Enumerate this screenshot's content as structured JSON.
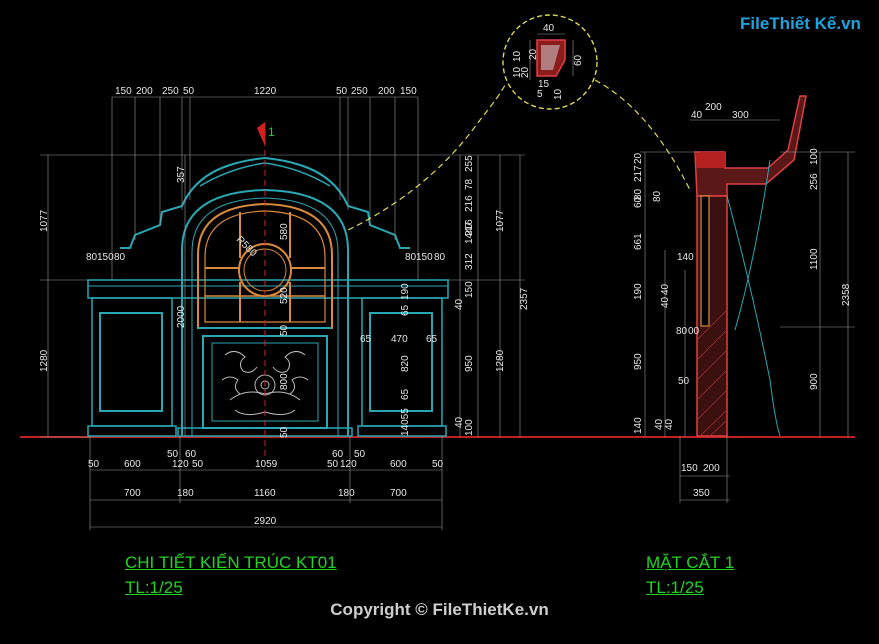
{
  "logo": {
    "part1": "File",
    "part2": "Thiết Kế",
    "part3": ".vn"
  },
  "section_marker": "1",
  "left_drawing": {
    "title": "CHI TIẾT KIẾN TRÚC KT01",
    "scale": "TL:1/25",
    "top_dims": [
      "150",
      "200",
      "250",
      "50",
      "1220",
      "50",
      "250",
      "200",
      "150"
    ],
    "bottom_dims_row1": [
      "50",
      "600",
      "50",
      "60",
      "120",
      "50",
      "1059",
      "50",
      "60",
      "120",
      "50",
      "600",
      "50"
    ],
    "bottom_dims_row2": [
      "700",
      "180",
      "1160",
      "180",
      "700"
    ],
    "total_width": "2920",
    "left_heights": [
      "1077",
      "1280"
    ],
    "inner_heights": [
      "357",
      "2000"
    ],
    "window_labels": [
      "R580",
      "580",
      "520",
      "50",
      "800",
      "50"
    ],
    "side_small": [
      "80",
      "150",
      "80",
      "80",
      "150",
      "80"
    ],
    "right_column": [
      "255",
      "78",
      "216",
      "216",
      "1447",
      "312",
      "150",
      "190",
      "65",
      "820",
      "65",
      "14055",
      "40",
      "950",
      "40",
      "100"
    ],
    "far_right_heights": [
      "1077",
      "2357",
      "1280"
    ],
    "pier_dims": [
      "65",
      "470",
      "65"
    ]
  },
  "detail_callout": {
    "top": "40",
    "left_stack": [
      "10",
      "10",
      "20",
      "20"
    ],
    "right": "60",
    "bottom": [
      "15",
      "5",
      "10"
    ]
  },
  "right_drawing": {
    "title": "MẶT CẮT 1",
    "scale": "TL:1/25",
    "top_dims": [
      "40",
      "200",
      "300"
    ],
    "left_column": [
      "20",
      "217",
      "80",
      "60",
      "661",
      "190",
      "950",
      "140"
    ],
    "inner_column": [
      "80",
      "140",
      "40",
      "40",
      "80",
      "00",
      "50",
      "40",
      "40"
    ],
    "right_column": [
      "100",
      "256",
      "1100",
      "900"
    ],
    "total_height": "2358",
    "bottom_dims": [
      "150",
      "200",
      "350"
    ]
  },
  "copyright": "Copyright © FileThietKe.vn"
}
